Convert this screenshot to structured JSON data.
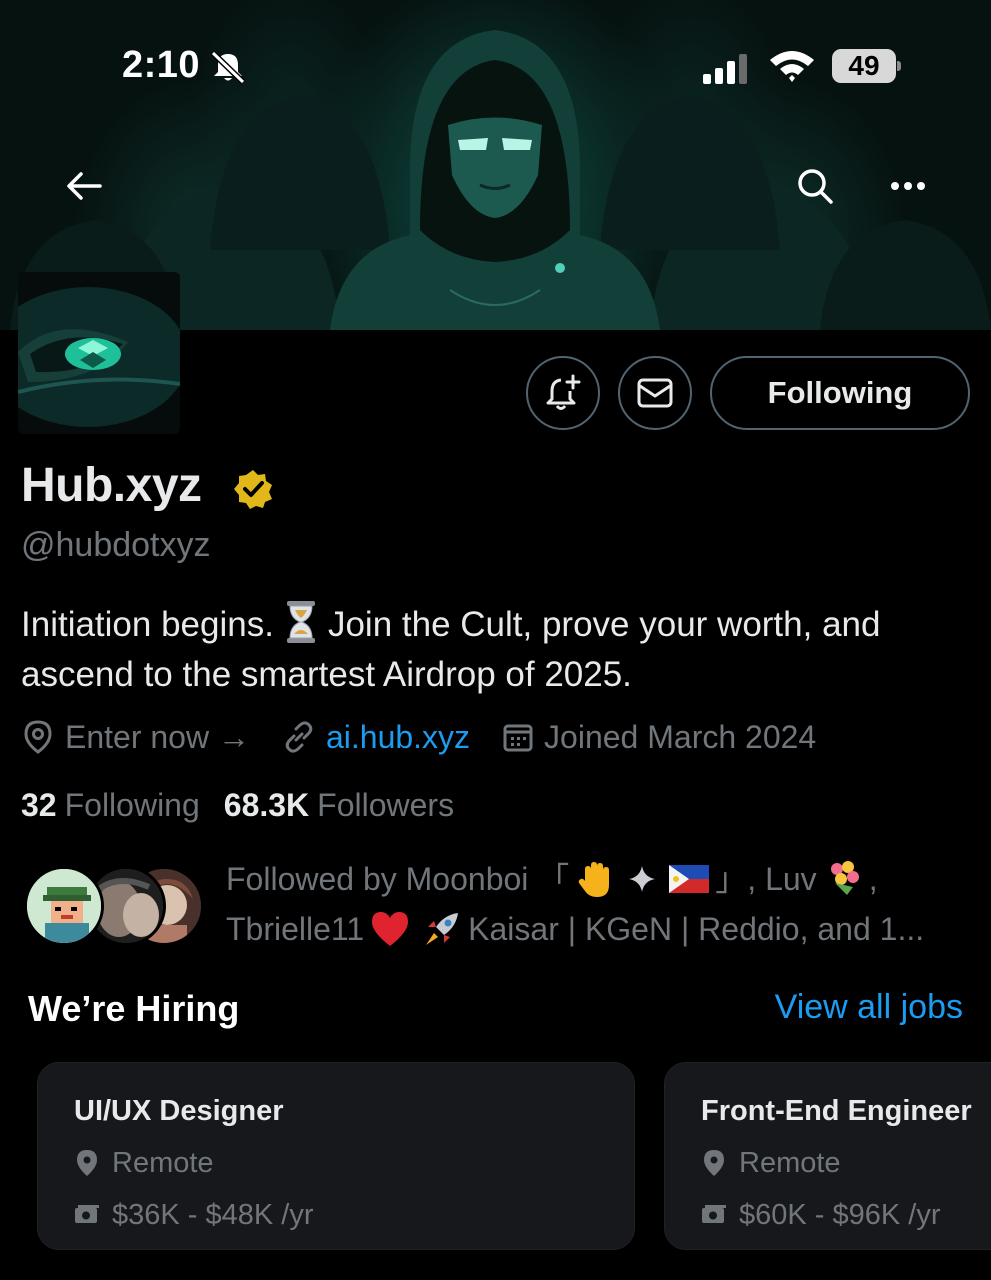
{
  "status_bar": {
    "time": "2:10",
    "battery": "49",
    "icons": [
      "bell-off-icon",
      "signal-icon",
      "wifi-icon",
      "battery-icon"
    ]
  },
  "nav": {
    "icons": [
      "back-arrow-icon",
      "search-icon",
      "more-icon"
    ]
  },
  "actions": {
    "notify_icon": "bell-plus-icon",
    "message_icon": "mail-icon",
    "following_label": "Following"
  },
  "profile": {
    "display_name": "Hub.xyz",
    "handle": "@hubdotxyz",
    "bio_part1": "Initiation begins.",
    "bio_part2": "Join the Cult, prove your worth, and",
    "bio_line2": "ascend to the smartest Airdrop of 2025.",
    "location": "Enter now →",
    "link": "ai.hub.xyz",
    "joined": "Joined March 2024",
    "following_count": "32",
    "following_label": "Following",
    "followers_count": "68.3K",
    "followers_label": "Followers",
    "verified_color": "#e2b719",
    "accent": "#1d9bf0"
  },
  "followed_by": {
    "line1_a": "Followed by Moonboi 「",
    "line1_b": "」, Luv",
    "line1_c": ",",
    "line2_a": "Tbrielle11",
    "line2_b": "Kaisar | KGeN | Reddio, and 1..."
  },
  "hiring": {
    "title": "We’re Hiring",
    "view_all": "View all jobs",
    "jobs": [
      {
        "title": "UI/UX Designer",
        "location": "Remote",
        "salary": "$36K - $48K /yr"
      },
      {
        "title": "Front-End Engineer",
        "location": "Remote",
        "salary": "$60K - $96K /yr"
      }
    ]
  }
}
